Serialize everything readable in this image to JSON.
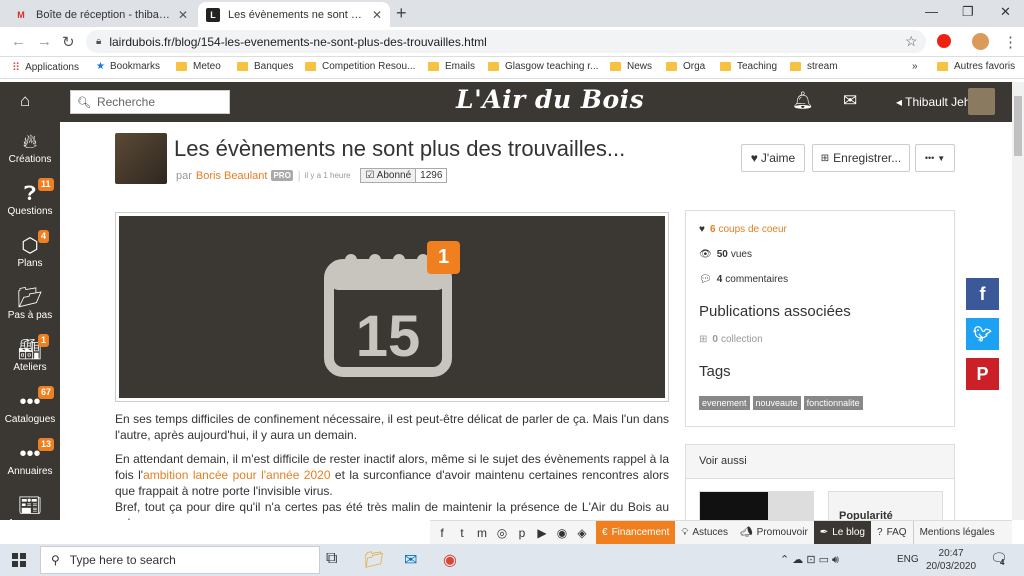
{
  "browser": {
    "tabs": [
      {
        "label": "Boîte de réception - thibault.jehl",
        "favicon": "M",
        "close": "✕"
      },
      {
        "label": "Les évènements ne sont plus des",
        "favicon": "L",
        "close": "✕"
      }
    ],
    "new_tab": "+",
    "url": "lairdubois.fr/blog/154-les-evenements-ne-sont-plus-des-trouvailles.html",
    "bookmarks": [
      "Applications",
      "Bookmarks",
      "Meteo",
      "Banques",
      "Competition Resou...",
      "Emails",
      "Glasgow teaching r...",
      "News",
      "Orga",
      "Teaching",
      "stream"
    ],
    "more_bookmarks": "»",
    "other_bookmarks": "Autres favoris"
  },
  "site": {
    "logo": "L'Air du Bois",
    "search_placeholder": "Recherche",
    "user": "Thibault Jehl",
    "sidebar": [
      {
        "label": "Créations",
        "badge": ""
      },
      {
        "label": "Questions",
        "badge": "11"
      },
      {
        "label": "Plans",
        "badge": "4"
      },
      {
        "label": "Pas à pas",
        "badge": ""
      },
      {
        "label": "Ateliers",
        "badge": "1"
      },
      {
        "label": "Catalogues",
        "badge": "67"
      },
      {
        "label": "Annuaires",
        "badge": "13"
      },
      {
        "label": "Annonces",
        "badge": ""
      }
    ]
  },
  "post": {
    "title": "Les évènements ne sont plus des trouvailles...",
    "by": "par",
    "author": "Boris Beaulant",
    "pro": "PRO",
    "ago": "il y a 1 heure",
    "follow_label": "Abonné",
    "follow_count": "1296",
    "like_label": "J'aime",
    "save_label": "Enregistrer...",
    "more_label": "•••",
    "hero": {
      "day": "15",
      "badge": "1"
    },
    "paragraphs": {
      "p1": "En ses temps difficiles de confinement nécessaire, il est peut-être délicat de parler de ça. Mais l'un dans l'autre, après aujourd'hui, il y aura un demain.",
      "p2a": "En attendant demain, il m'est difficile de rester inactif alors, même si le sujet des évènements rappel à la fois l'",
      "p2link": "ambition lancée pour l'année 2020",
      "p2b": " et la surconfiance d'avoir maintenu certaines rencontres alors que frappait à notre porte l'invisible virus.",
      "p3": "Bref, tout ça pour dire qu'il n'a certes pas été très malin de maintenir la présence de L'Air du Bois au salon"
    }
  },
  "panel": {
    "likes_count": "6",
    "likes_label": "coups de coeur",
    "views_count": "50",
    "views_label": "vues",
    "comments_count": "4",
    "comments_label": "commentaires",
    "pubs_title": "Publications associées",
    "collection_count": "0",
    "collection_label": "collection",
    "tags_title": "Tags",
    "tags": [
      "evenement",
      "nouveaute",
      "fonctionnalite"
    ],
    "voir_title": "Voir aussi",
    "thumb_text": "Popularité"
  },
  "footer": {
    "financement": "Financement",
    "astuces": "Astuces",
    "promouvoir": "Promouvoir",
    "blog": "Le blog",
    "faq": "FAQ",
    "mentions": "Mentions légales"
  },
  "taskbar": {
    "search": "Type here to search",
    "lang": "ENG",
    "time": "20:47",
    "date": "20/03/2020",
    "notif": "4"
  },
  "colors": {
    "accent": "#f0801f",
    "dark": "#3b3833",
    "facebook": "#3b5998",
    "twitter": "#1da1f2",
    "pinterest": "#cb2027"
  }
}
